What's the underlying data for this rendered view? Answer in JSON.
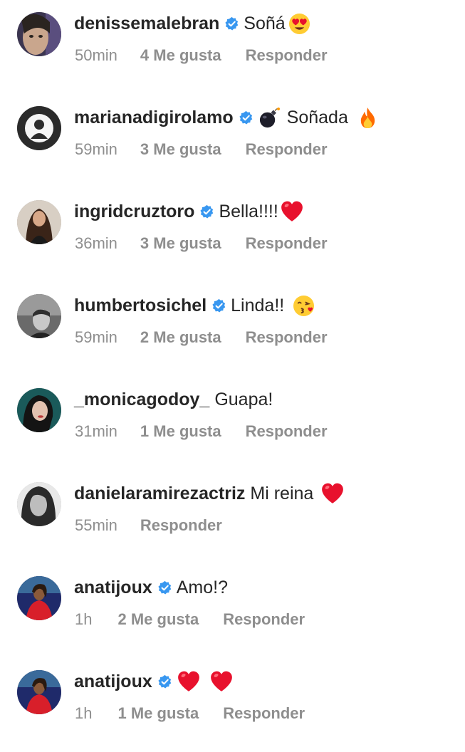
{
  "comments": [
    {
      "username": "denissemalebran",
      "verified": true,
      "text": "Soñá",
      "emojis": [
        "heart-eyes-face"
      ],
      "time": "50min",
      "likes": "4 Me gusta",
      "reply": "Responder"
    },
    {
      "username": "marianadigirolamo",
      "verified": true,
      "text_before": "",
      "emojis_before": [
        "bomb"
      ],
      "text": "Soñada",
      "emojis": [
        "fire"
      ],
      "time": "59min",
      "likes": "3 Me gusta",
      "reply": "Responder"
    },
    {
      "username": "ingridcruztoro",
      "verified": true,
      "text": "Bella!!!!",
      "emojis": [
        "red-heart"
      ],
      "time": "36min",
      "likes": "3 Me gusta",
      "reply": "Responder"
    },
    {
      "username": "humbertosichel",
      "verified": true,
      "text": "Linda!!",
      "emojis": [
        "kissing-face"
      ],
      "time": "59min",
      "likes": "2 Me gusta",
      "reply": "Responder"
    },
    {
      "username": "_monicagodoy_",
      "verified": false,
      "text": "Guapa!",
      "emojis": [],
      "time": "31min",
      "likes": "1 Me gusta",
      "reply": "Responder"
    },
    {
      "username": "danielaramirezactriz",
      "verified": false,
      "text": "Mi reina",
      "emojis": [
        "red-heart"
      ],
      "time": "55min",
      "likes": "",
      "reply": "Responder"
    },
    {
      "username": "anatijoux",
      "verified": true,
      "text": "Amo!?",
      "emojis": [],
      "time": "1h",
      "likes": "2 Me gusta",
      "reply": "Responder"
    },
    {
      "username": "anatijoux",
      "verified": true,
      "text": "",
      "emojis": [
        "red-heart",
        "red-heart"
      ],
      "time": "1h",
      "likes": "1 Me gusta",
      "reply": "Responder"
    }
  ],
  "colors": {
    "username": "#262626",
    "meta": "#8e8e8e",
    "verified_badge": "#3897f0",
    "heart": "#e8112d"
  }
}
